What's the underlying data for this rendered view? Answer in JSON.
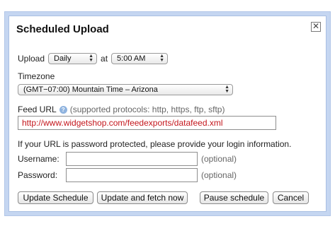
{
  "dialog": {
    "title": "Scheduled Upload",
    "close_glyph": "✕"
  },
  "upload": {
    "label": "Upload",
    "frequency": "Daily",
    "at_label": "at",
    "time": "5:00 AM"
  },
  "timezone": {
    "label": "Timezone",
    "value": "(GMT−07:00) Mountain Time – Arizona"
  },
  "feed_url": {
    "label": "Feed URL",
    "help_glyph": "?",
    "protocols_hint": "(supported protocols: http, https, ftp, sftp)",
    "value": "http://www.widgetshop.com/feedexports/datafeed.xml"
  },
  "auth": {
    "instructions": "If your URL is password protected, please provide your login information.",
    "username_label": "Username:",
    "username_value": "",
    "username_optional": "(optional)",
    "password_label": "Password:",
    "password_value": "",
    "password_optional": "(optional)"
  },
  "buttons": {
    "update_schedule": "Update Schedule",
    "update_and_fetch": "Update and fetch now",
    "pause_schedule": "Pause schedule",
    "cancel": "Cancel"
  },
  "colors": {
    "frame_background": "#c5d6f1",
    "url_text": "#c4161c",
    "help_icon": "#8fb3df"
  },
  "icons": {
    "close": "close-icon",
    "help": "help-icon",
    "dropdown": "chevron-updown-icon"
  }
}
